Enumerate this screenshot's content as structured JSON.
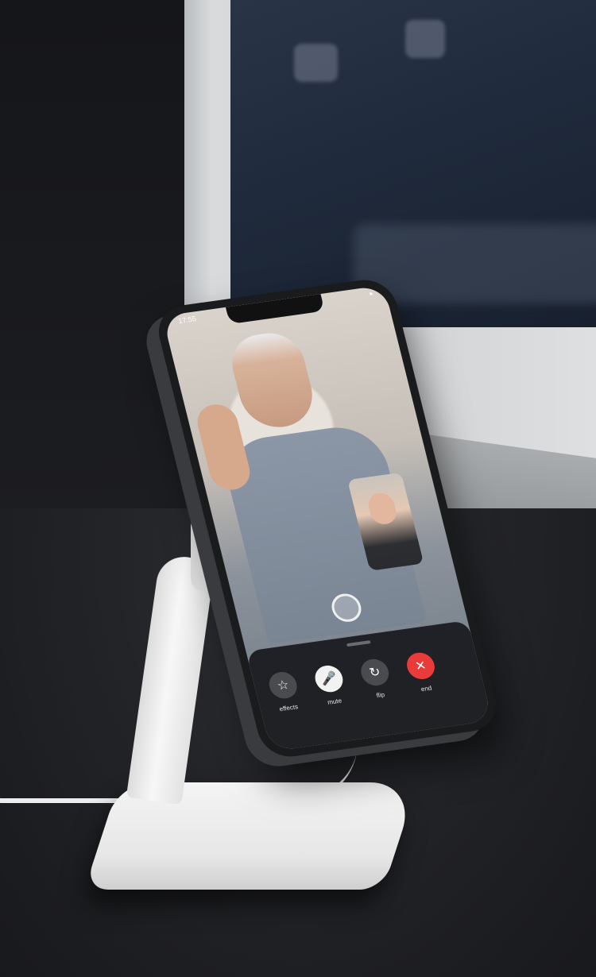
{
  "phone": {
    "status_time": "17:55",
    "call_controls": [
      {
        "label": "effects",
        "icon": "star-effects-icon"
      },
      {
        "label": "mute",
        "icon": "mic-slash-icon"
      },
      {
        "label": "flip",
        "icon": "camera-flip-icon"
      },
      {
        "label": "end",
        "icon": "close-icon"
      }
    ]
  },
  "colors": {
    "end_button": "#ea3b3b",
    "control_bar": "#1c1d21"
  }
}
